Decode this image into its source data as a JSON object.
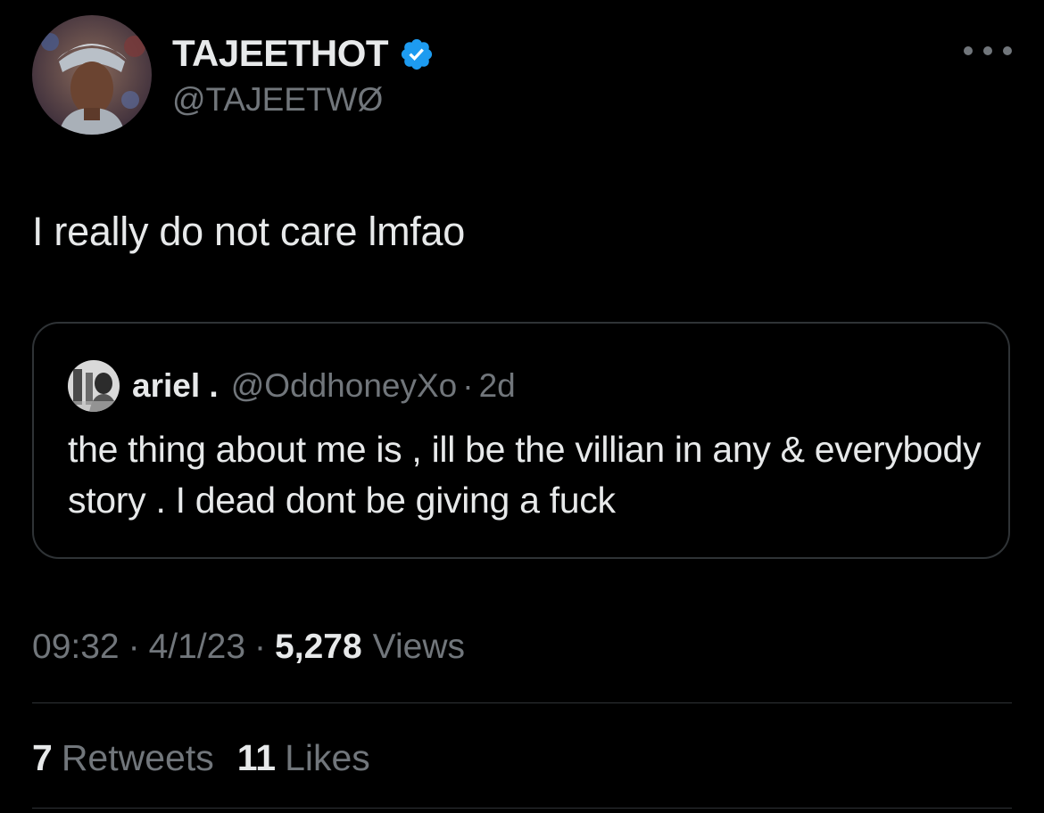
{
  "author": {
    "display_name": "TAJEETHOT",
    "handle": "@TAJEETWØ",
    "verified": true,
    "avatar_icon": "profile-photo",
    "badge_color": "#1d9bf0"
  },
  "more_icon": "more-horizontal-icon",
  "tweet": {
    "text": "I really do not care lmfao"
  },
  "quote": {
    "name": "ariel .",
    "handle": "@OddhoneyXo",
    "separator": "·",
    "time": "2d",
    "avatar_icon": "profile-photo",
    "text": "the thing about me is , ill be the villian in any & everybody story . I dead dont be giving a fuck"
  },
  "meta": {
    "time": "09:32",
    "date": "4/1/23",
    "separator": "·",
    "views_count": "5,278",
    "views_label": "Views"
  },
  "stats": {
    "retweets_count": "7",
    "retweets_label": "Retweets",
    "likes_count": "11",
    "likes_label": "Likes"
  },
  "colors": {
    "background": "#000000",
    "primary_text": "#e7e9ea",
    "secondary_text": "#71767b",
    "border": "#2f3336",
    "verified_blue": "#1d9bf0"
  }
}
